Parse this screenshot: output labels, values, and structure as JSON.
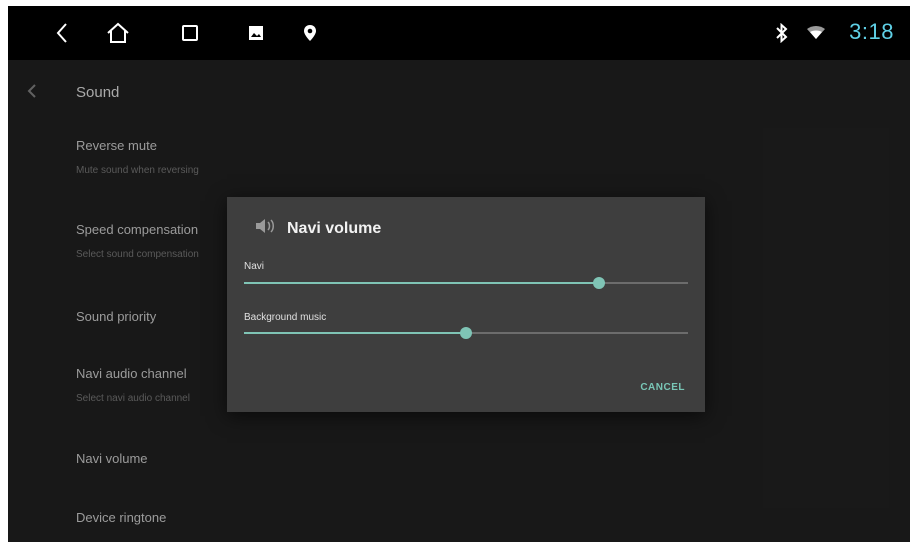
{
  "statusbar": {
    "icons": [
      "back-icon",
      "home-icon",
      "recents-icon",
      "gallery-icon",
      "location-icon",
      "bluetooth-icon",
      "wifi-icon"
    ],
    "time": "3:18",
    "accent": "#5fd0e6"
  },
  "appbar": {
    "title": "Sound"
  },
  "settings": [
    {
      "title": "Reverse mute",
      "subtitle": "Mute sound when reversing"
    },
    {
      "title": "Speed compensation",
      "subtitle": "Select sound compensation"
    },
    {
      "title": "Sound priority",
      "subtitle": ""
    },
    {
      "title": "Navi audio channel",
      "subtitle": "Select navi audio channel"
    },
    {
      "title": "Navi volume",
      "subtitle": ""
    },
    {
      "title": "Device ringtone",
      "subtitle": ""
    }
  ],
  "dialog": {
    "title": "Navi volume",
    "icon": "speaker-icon",
    "sliders": [
      {
        "label": "Navi",
        "value": 0.8
      },
      {
        "label": "Background music",
        "value": 0.5
      }
    ],
    "cancel_label": "CANCEL",
    "accent": "#7fc4b5"
  }
}
